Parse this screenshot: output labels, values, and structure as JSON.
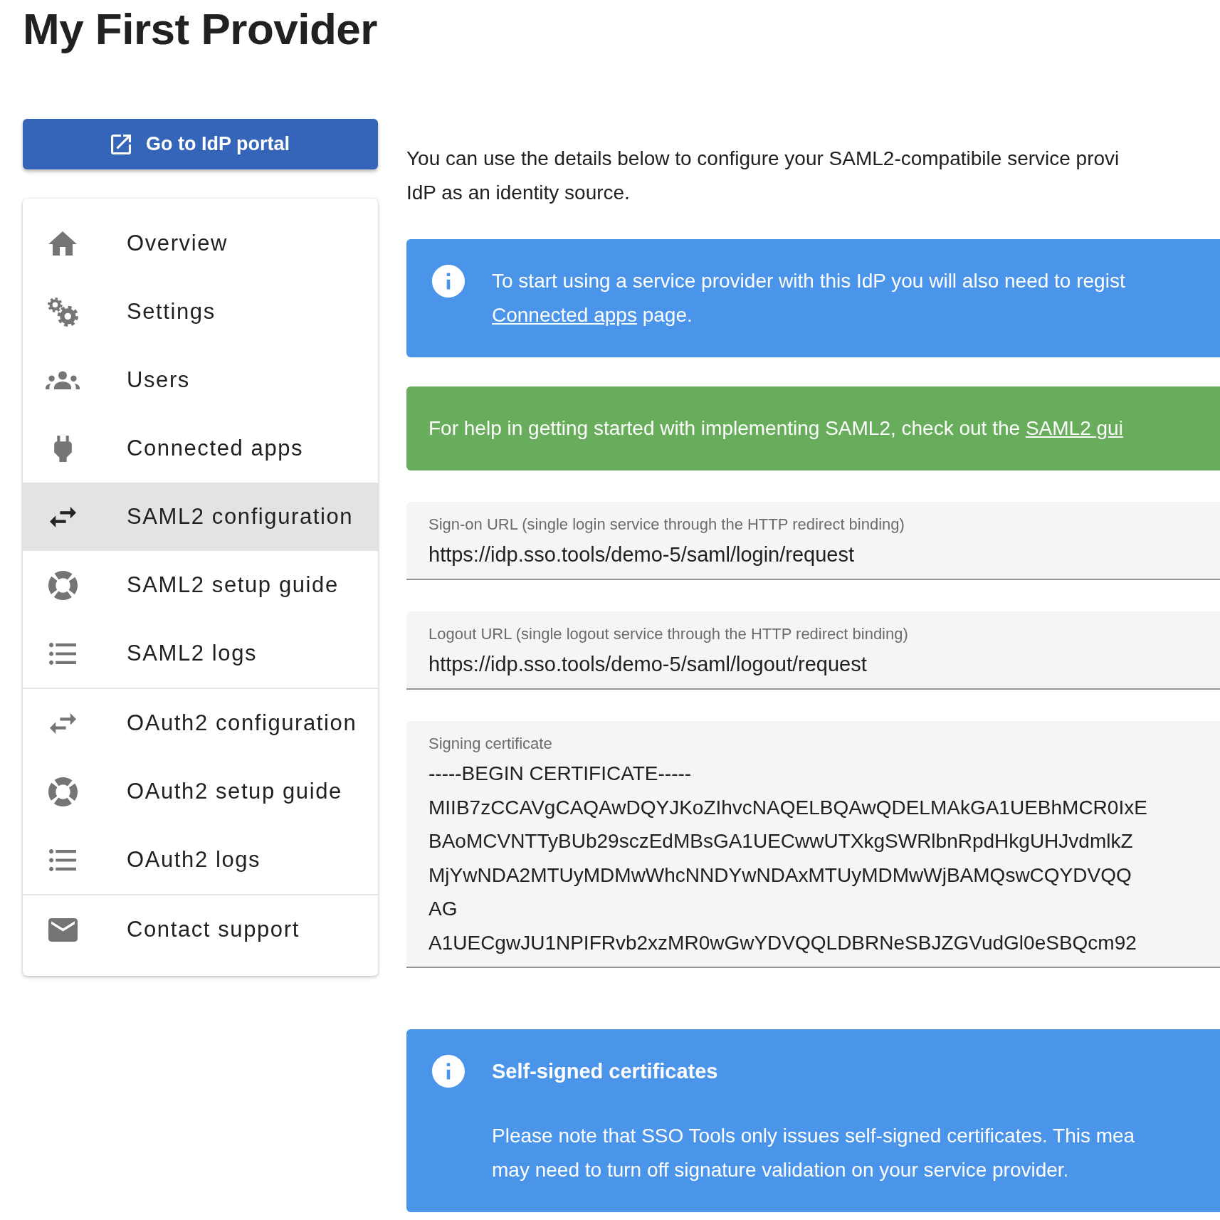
{
  "page": {
    "title": "My First Provider"
  },
  "portal_button": {
    "label": "Go to IdP portal"
  },
  "sidebar": {
    "groups": [
      {
        "items": [
          {
            "label": "Overview",
            "selected": false
          },
          {
            "label": "Settings",
            "selected": false
          },
          {
            "label": "Users",
            "selected": false
          },
          {
            "label": "Connected apps",
            "selected": false
          },
          {
            "label": "SAML2 configuration",
            "selected": true
          },
          {
            "label": "SAML2 setup guide",
            "selected": false
          },
          {
            "label": "SAML2 logs",
            "selected": false
          }
        ]
      },
      {
        "items": [
          {
            "label": "OAuth2 configuration",
            "selected": false
          },
          {
            "label": "OAuth2 setup guide",
            "selected": false
          },
          {
            "label": "OAuth2 logs",
            "selected": false
          }
        ]
      },
      {
        "items": [
          {
            "label": "Contact support",
            "selected": false
          }
        ]
      }
    ]
  },
  "content": [
    {
      "kind": "paragraph",
      "lines": [
        [
          {
            "text": "You can use the details below to configure your SAML2-compatibile service provi"
          }
        ],
        [
          {
            "text": "IdP as an identity source."
          }
        ]
      ]
    },
    {
      "kind": "info",
      "lines": [
        [
          {
            "text": "To start using a service provider with this IdP you will also need to regist"
          }
        ],
        [
          {
            "link": "Connected apps"
          },
          {
            "text": "page."
          }
        ]
      ]
    },
    {
      "kind": "success",
      "lines": [
        [
          {
            "text": "For help in getting started with implementing SAML2, check out the"
          },
          {
            "link": "SAML2 gui"
          }
        ]
      ]
    },
    {
      "kind": "field",
      "label": "Sign-on URL (single login service through the HTTP redirect binding)",
      "lines": [
        "https://idp.sso.tools/demo-5/saml/login/request"
      ]
    },
    {
      "kind": "field",
      "label": "Logout URL (single logout service through the HTTP redirect binding)",
      "lines": [
        "https://idp.sso.tools/demo-5/saml/logout/request"
      ]
    },
    {
      "kind": "field",
      "label": "Signing certificate",
      "lines": [
        "-----BEGIN CERTIFICATE-----",
        "MIIB7zCCAVgCAQAwDQYJKoZIhvcNAQELBQAwQDELMAkGA1UEBhMCR0IxE",
        "BAoMCVNTTyBUb29sczEdMBsGA1UECwwUTXkgSWRlbnRpdHkgUHJvdmlkZ",
        "MjYwNDA2MTUyMDMwWhcNNDYwNDAxMTUyMDMwWjBAMQswCQYDVQQ",
        "AG",
        "A1UECgwJU1NPIFRvb2xzMR0wGwYDVQQLDBRNeSBJZGVudGl0eSBQcm92"
      ]
    },
    {
      "kind": "info",
      "title": "Self-signed certificates",
      "lines": [
        [
          {
            "text": "Please note that SSO Tools only issues self-signed certificates. This mea"
          }
        ],
        [
          {
            "text": "may need to turn off signature validation on your service provider."
          }
        ]
      ]
    }
  ]
}
